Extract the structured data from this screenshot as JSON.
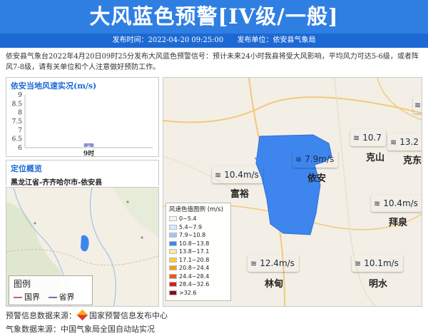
{
  "title": "大风蓝色预警[IV级/一般]",
  "meta": {
    "publish_time_label": "发布时间：2022-04-20 09:25:00",
    "publisher_label": "发布单位：依安县气象局"
  },
  "description": "依安县气象台2022年4月20日09时25分发布大风蓝色预警信号：预计未来24小时我县将受大风影响，平均风力可达5-6级，或者阵风7-8级，请有关单位和个人注意做好预防工作。",
  "wind_chart": {
    "title": "依安当地风速实况(m/s)"
  },
  "chart_data": {
    "type": "bar",
    "categories": [
      "9时"
    ],
    "values": [
      6
    ],
    "data_labels": [
      "6"
    ],
    "yticks": [
      "9",
      "8.5",
      "8",
      "7.5",
      "7",
      "6.5",
      "6"
    ],
    "ylim": [
      6,
      9
    ],
    "bar_color": "#8a8fd6"
  },
  "location": {
    "title": "定位概览",
    "path": "黑龙江省-齐齐哈尔市-依安县"
  },
  "map_legend": {
    "title": "图例",
    "items": [
      {
        "label": "国界",
        "color": "#c6607a"
      },
      {
        "label": "省界",
        "color": "#6f6fa8"
      }
    ]
  },
  "speed_legend": {
    "title": "风速色值图例 (m/s)",
    "items": [
      {
        "label": "0~5.4",
        "color": "#f4f4f4"
      },
      {
        "label": "5.4~7.9",
        "color": "#d6e9fb"
      },
      {
        "label": "7.9~10.8",
        "color": "#9cc9f5"
      },
      {
        "label": "10.8~13.8",
        "color": "#3e86ee"
      },
      {
        "label": "13.8~17.1",
        "color": "#f6e9a4"
      },
      {
        "label": "17.1~20.8",
        "color": "#f3cf3b"
      },
      {
        "label": "20.8~24.4",
        "color": "#f09b25"
      },
      {
        "label": "24.4~28.4",
        "color": "#e65a1e"
      },
      {
        "label": "28.4~32.6",
        "color": "#c8231c"
      },
      {
        "label": ">32.6",
        "color": "#8a0c12"
      }
    ]
  },
  "stations": [
    {
      "city": "依安",
      "speed": "7.9m/s",
      "color": "#9cc9f5"
    },
    {
      "city": "富裕",
      "speed": "10.4m/s",
      "color": "#9cc9f5"
    },
    {
      "city": "克山",
      "speed": "10.7",
      "color": "#9cc9f5"
    },
    {
      "city": "克东",
      "speed": "13.2",
      "color": "#3e86ee"
    },
    {
      "city": "拜泉",
      "speed": "10.4m/s",
      "color": "#9cc9f5"
    },
    {
      "city": "林甸",
      "speed": "12.4m/s",
      "color": "#3e86ee"
    },
    {
      "city": "明水",
      "speed": "10.1m/s",
      "color": "#9cc9f5"
    }
  ],
  "wind_icon": "wind-icon",
  "footer": {
    "warning_source": "预警信息数据来源：",
    "warning_source_name": "国家预警信息发布中心",
    "weather_source": "气象数据来源：中国气象局全国自动站实况"
  }
}
